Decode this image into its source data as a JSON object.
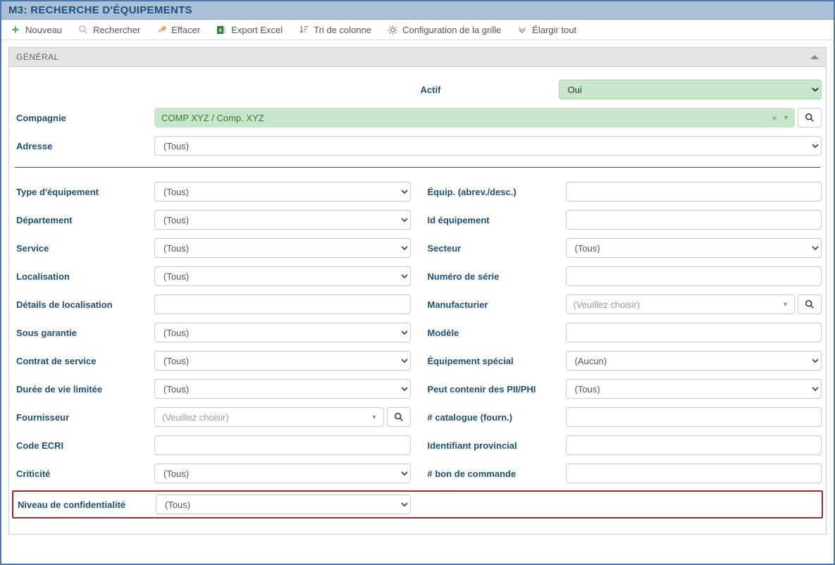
{
  "window": {
    "title": "M3: RECHERCHE D'ÉQUIPEMENTS"
  },
  "toolbar": {
    "nouveau": "Nouveau",
    "rechercher": "Rechercher",
    "effacer": "Effacer",
    "export_excel": "Export Excel",
    "tri_colonne": "Tri de colonne",
    "config_grille": "Configuration de la grille",
    "elargir": "Élargir tout"
  },
  "panel": {
    "header": "GÉNÉRAL",
    "actif": {
      "label": "Actif",
      "value": "Oui"
    },
    "compagnie": {
      "label": "Compagnie",
      "value": "COMP XYZ / Comp. XYZ"
    },
    "adresse": {
      "label": "Adresse",
      "value": "(Tous)"
    },
    "type_equip": {
      "label": "Type d'équipement",
      "value": "(Tous)"
    },
    "equip_abrev": {
      "label": "Équip. (abrev./desc.)"
    },
    "departement": {
      "label": "Département",
      "value": "(Tous)"
    },
    "id_equip": {
      "label": "Id équipement"
    },
    "service": {
      "label": "Service",
      "value": "(Tous)"
    },
    "secteur": {
      "label": "Secteur",
      "value": "(Tous)"
    },
    "localisation": {
      "label": "Localisation",
      "value": "(Tous)"
    },
    "numero_serie": {
      "label": "Numéro de série"
    },
    "details_loc": {
      "label": "Détails de localisation"
    },
    "manufacturier": {
      "label": "Manufacturier",
      "placeholder": "(Veuillez choisir)"
    },
    "sous_garantie": {
      "label": "Sous garantie",
      "value": "(Tous)"
    },
    "modele": {
      "label": "Modèle"
    },
    "contrat_service": {
      "label": "Contrat de service",
      "value": "(Tous)"
    },
    "equip_special": {
      "label": "Équipement spécial",
      "value": "(Aucun)"
    },
    "duree_vie": {
      "label": "Durée de vie limitée",
      "value": "(Tous)"
    },
    "pii_phi": {
      "label": "Peut contenir des PII/PHI",
      "value": "(Tous)"
    },
    "fournisseur": {
      "label": "Fournisseur",
      "placeholder": "(Veuillez choisir)"
    },
    "catalogue_fourn": {
      "label": "# catalogue (fourn.)"
    },
    "code_ecri": {
      "label": "Code ECRI"
    },
    "id_provincial": {
      "label": "Identifiant provincial"
    },
    "criticite": {
      "label": "Criticité",
      "value": "(Tous)"
    },
    "bon_commande": {
      "label": "# bon de commande"
    },
    "niveau_conf": {
      "label": "Niveau de confidentialité",
      "value": "(Tous)"
    }
  }
}
